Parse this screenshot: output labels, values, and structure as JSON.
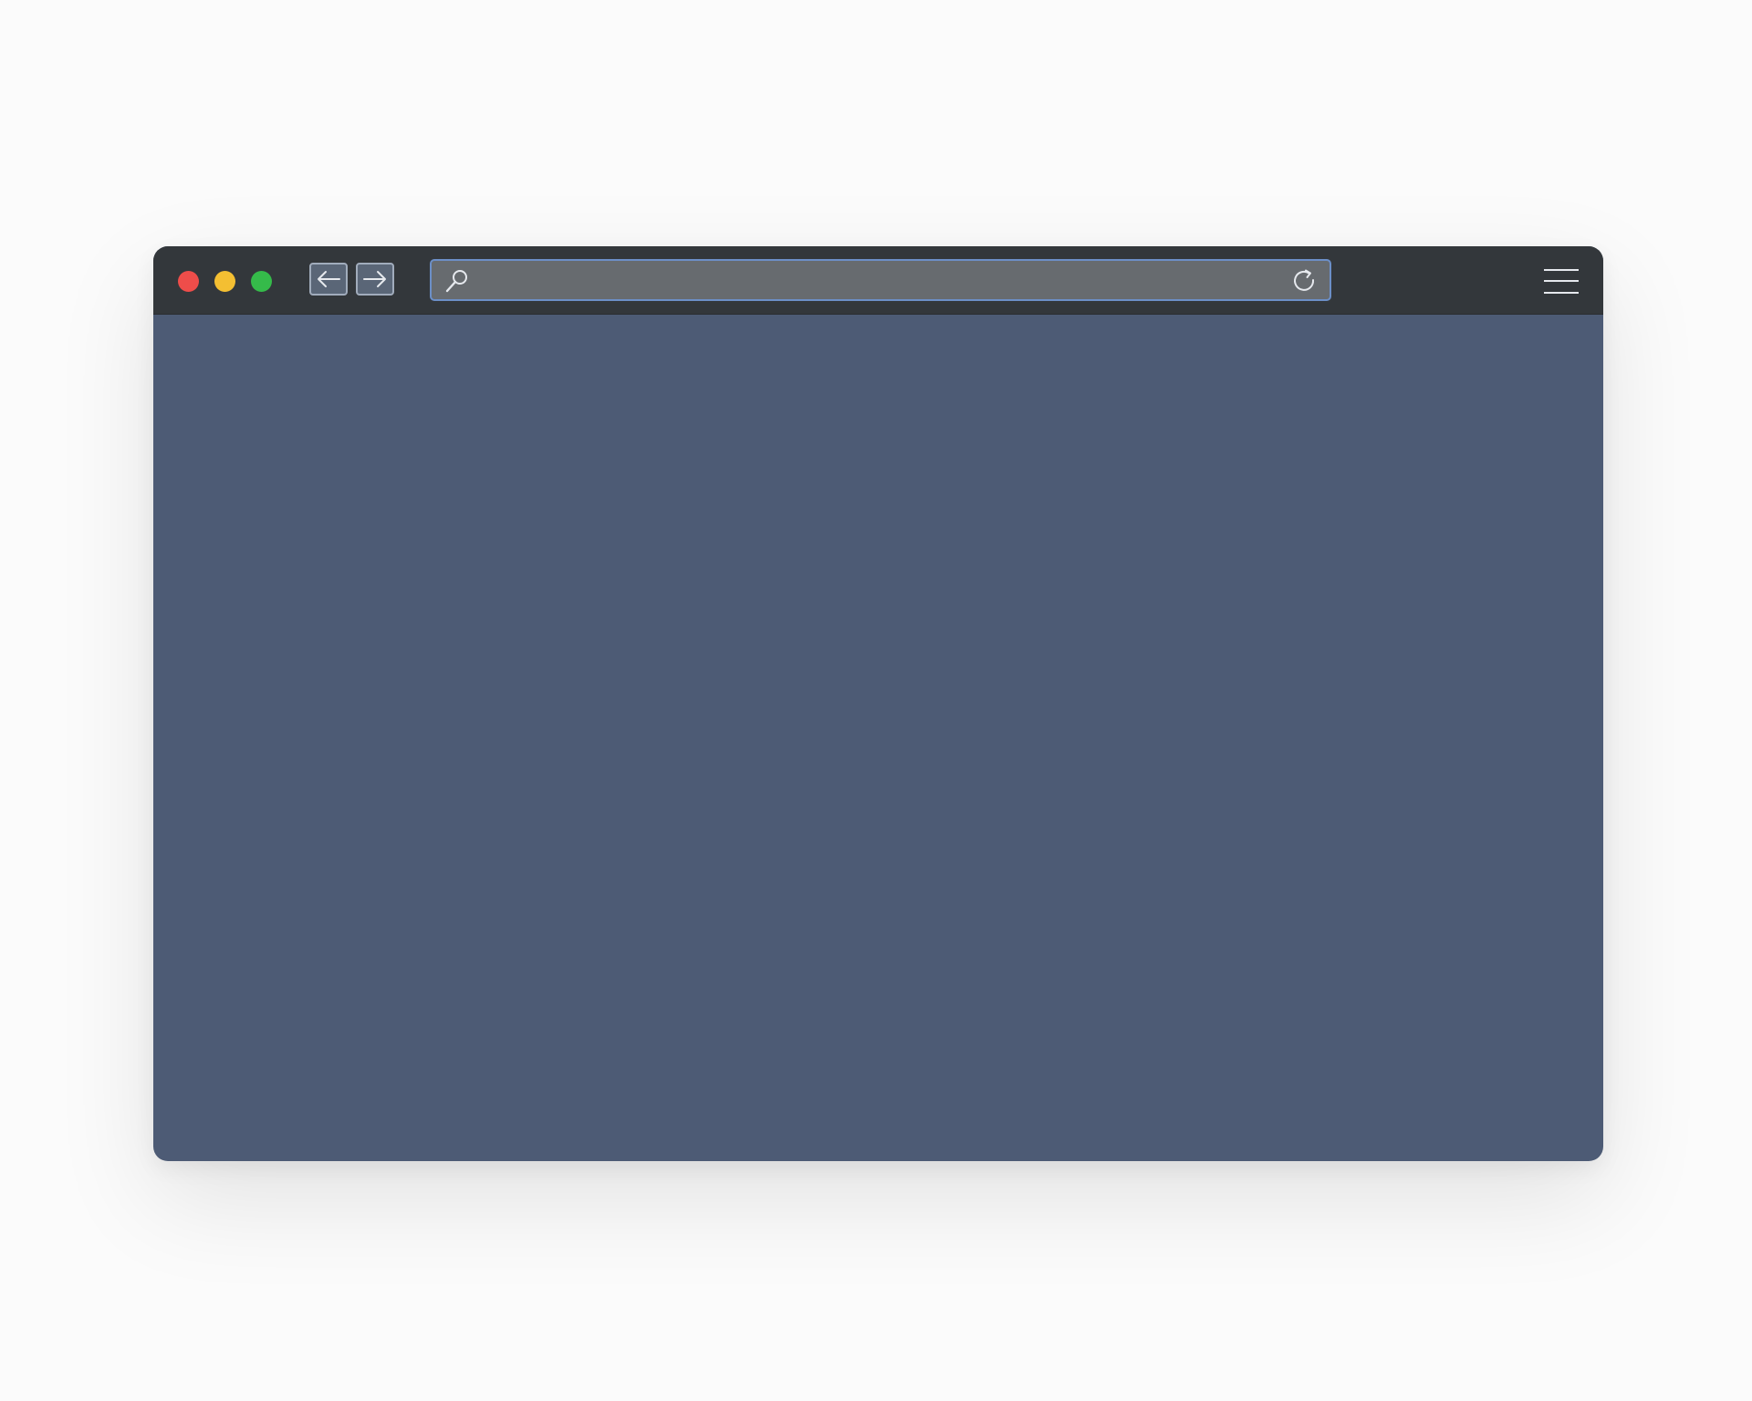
{
  "window": {
    "toolbar_color": "#33373b",
    "content_color": "#4d5b75"
  },
  "traffic_lights": [
    {
      "name": "close",
      "color": "#ee4d4a"
    },
    {
      "name": "minimize",
      "color": "#f4bf32"
    },
    {
      "name": "maximize",
      "color": "#35bb4a"
    }
  ],
  "navigation": {
    "back_icon": "arrow-left-icon",
    "forward_icon": "arrow-right-icon"
  },
  "address_bar": {
    "value": "",
    "placeholder": "",
    "search_icon": "search-icon",
    "reload_icon": "reload-icon",
    "border_color": "#6c8fc7"
  },
  "menu": {
    "icon": "hamburger-menu-icon"
  }
}
